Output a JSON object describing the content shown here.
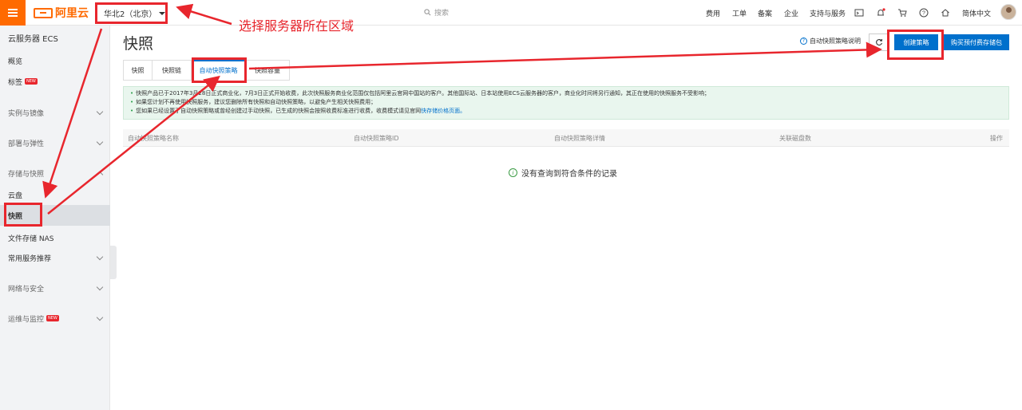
{
  "topbar": {
    "logo_text": "阿里云",
    "region": "华北2（北京）",
    "search_placeholder": "搜索",
    "nav": [
      "费用",
      "工单",
      "备案",
      "企业",
      "支持与服务"
    ],
    "language": "简体中文"
  },
  "sidebar": {
    "title": "云服务器 ECS",
    "overview": "概览",
    "tags": "标签",
    "tags_badge": "NEW",
    "instances": "实例与镜像",
    "deploy": "部署与弹性",
    "storage": "存储与快照",
    "disk": "云盘",
    "snapshot": "快照",
    "nas": "文件存储 NAS",
    "common": "常用服务推荐",
    "network": "网络与安全",
    "ops": "运维与监控",
    "ops_badge": "NEW"
  },
  "main": {
    "title": "快照",
    "help_link": "自动快照策略说明",
    "create_button": "创建策略",
    "buy_button": "购买预付费存储包",
    "tabs": [
      "快照",
      "快照链",
      "自动快照策略",
      "快照容量"
    ],
    "notice": [
      "快照产品已于2017年3月28日正式商业化，7月3日正式开始收费，此次快照服务商业化范围仅包括阿里云官网中国站的客户。其他国际站、日本站使用ECS云服务器的客户，商业化时间将另行通知，其正在使用的快照服务不受影响；",
      "如果您计划不再使用快照服务，建议您删除所有快照和自动快照策略，以避免产生相关快照费用；",
      "您如果已经设置了自动快照策略或曾经创建过手动快照，已生成的快照会按照收费标准进行收费，收费模式请见官网"
    ],
    "notice_link": "快存储价格页面。",
    "columns": [
      "自动快照策略名称",
      "自动快照策略ID",
      "自动快照策略详情",
      "关联磁盘数",
      "操作"
    ],
    "empty_text": "没有查询到符合条件的记录"
  },
  "annotation": {
    "text": "选择服务器所在区域"
  },
  "colors": {
    "brand": "#ff6a00",
    "primary": "#0070cc",
    "annotation_red": "#e8262d"
  }
}
